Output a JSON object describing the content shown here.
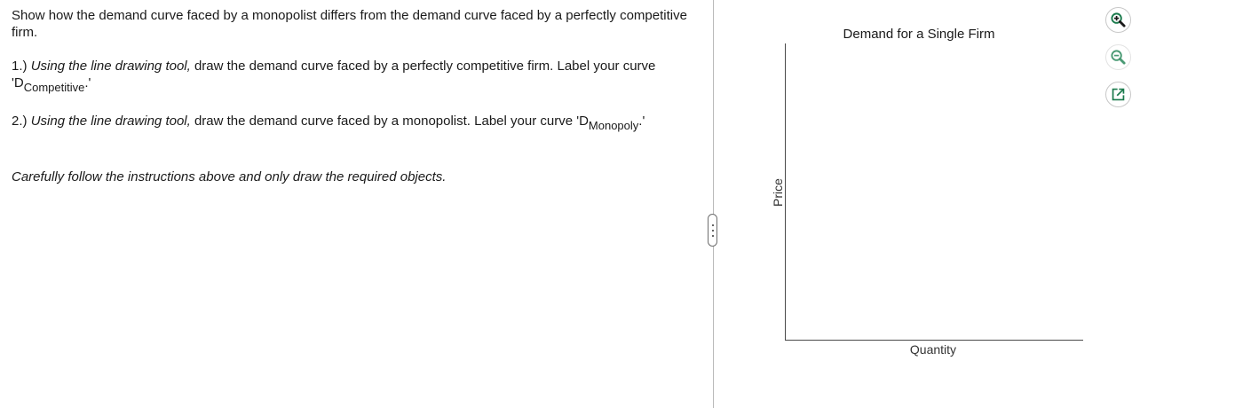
{
  "question": {
    "intro": "Show how the demand curve faced by a monopolist differs from the demand curve faced by a perfectly competitive firm.",
    "step1": {
      "number": "1.) ",
      "tool_phrase": "Using the line drawing tool,",
      "text": " draw the demand curve   faced by a perfectly competitive firm. Label your curve 'D",
      "subscript": "Competitive",
      "suffix": ".'"
    },
    "step2": {
      "number": "2.) ",
      "tool_phrase": "Using the line drawing tool,",
      "text": " draw the demand curve faced by a monopolist. Label your curve 'D",
      "subscript": "Monopoly",
      "suffix": ".'"
    },
    "note": "Carefully follow the instructions above and only draw the required objects."
  },
  "graph": {
    "title": "Demand for a Single Firm",
    "x_axis_label": "Quantity",
    "y_axis_label": "Price"
  },
  "tools": {
    "zoom_in_icon": "zoom-in-icon",
    "zoom_out_icon": "zoom-out-icon",
    "popout_icon": "popout-icon",
    "accent_color": "#1a7a4c"
  }
}
